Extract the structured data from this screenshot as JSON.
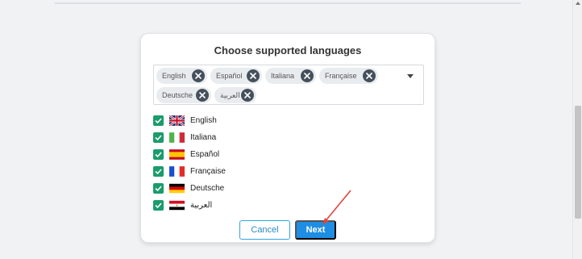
{
  "dialog": {
    "title": "Choose supported languages",
    "selected_chips": [
      {
        "label": "English"
      },
      {
        "label": "Español"
      },
      {
        "label": "Italiana"
      },
      {
        "label": "Française"
      },
      {
        "label": "Deutsche"
      },
      {
        "label": "العربية"
      }
    ],
    "languages": [
      {
        "label": "English",
        "checked": true,
        "flag": "uk-flag-icon"
      },
      {
        "label": "Italiana",
        "checked": true,
        "flag": "italy-flag-icon"
      },
      {
        "label": "Español",
        "checked": true,
        "flag": "spain-flag-icon"
      },
      {
        "label": "Française",
        "checked": true,
        "flag": "france-flag-icon"
      },
      {
        "label": "Deutsche",
        "checked": true,
        "flag": "germany-flag-icon"
      },
      {
        "label": "العربية",
        "checked": true,
        "flag": "egypt-flag-icon"
      }
    ],
    "cancel_label": "Cancel",
    "next_label": "Next"
  },
  "colors": {
    "accent": "#1d8ee3",
    "checkbox": "#1a9c6c",
    "annotation_arrow": "#e0453a"
  }
}
